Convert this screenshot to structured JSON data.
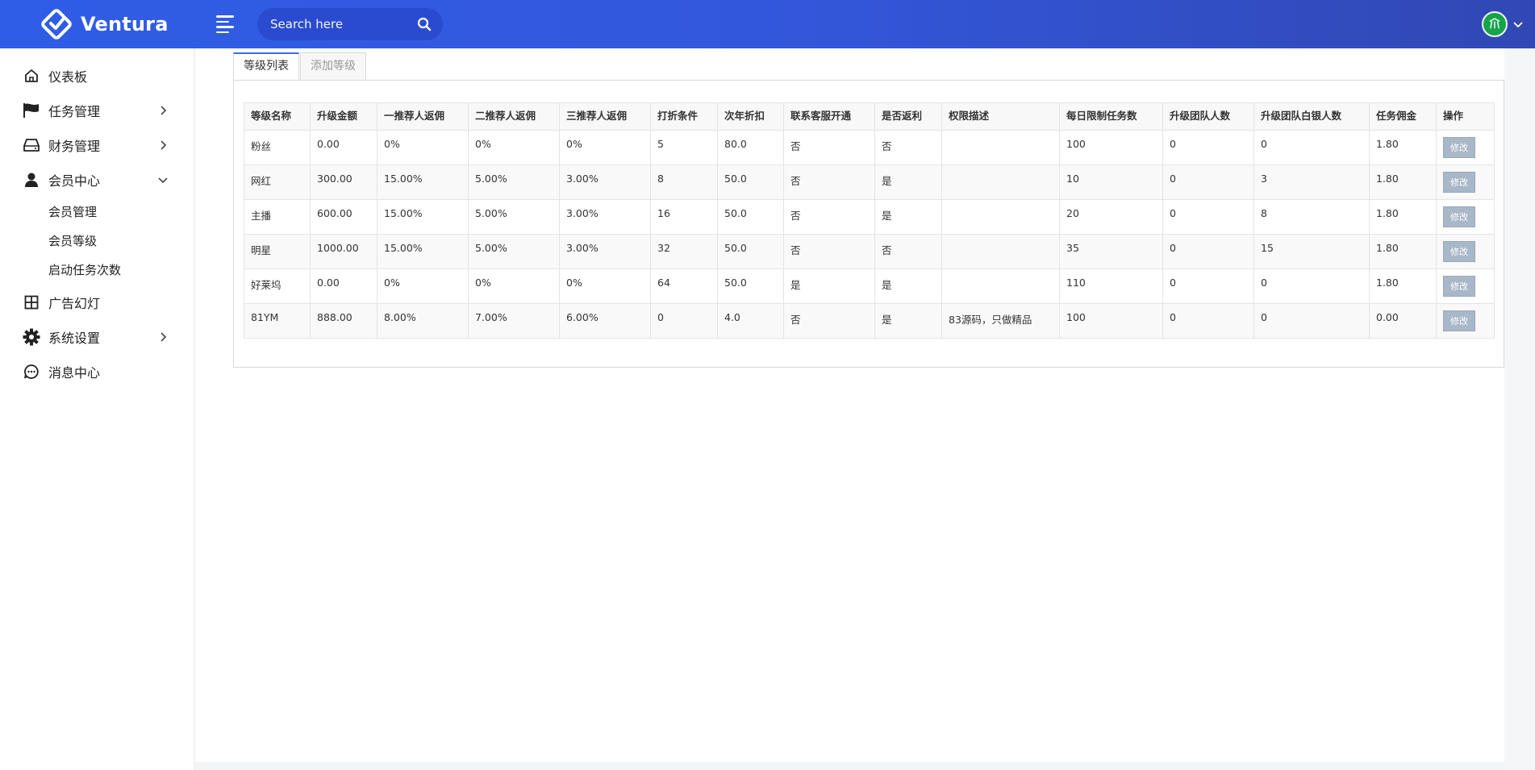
{
  "brand": {
    "name": "Ventura"
  },
  "search": {
    "placeholder": "Search here"
  },
  "sidebar": {
    "items": [
      {
        "label": "仪表板",
        "icon": "home-icon"
      },
      {
        "label": "任务管理",
        "icon": "flag-icon"
      },
      {
        "label": "财务管理",
        "icon": "drive-icon"
      },
      {
        "label": "会员中心",
        "icon": "user-icon"
      },
      {
        "label": "广告幻灯",
        "icon": "grid-icon"
      },
      {
        "label": "系统设置",
        "icon": "gear-icon"
      },
      {
        "label": "消息中心",
        "icon": "chat-icon"
      }
    ],
    "member_sub": [
      "会员管理",
      "会员等级",
      "启动任务次数"
    ]
  },
  "tabs": {
    "list": "等级列表",
    "add": "添加等级"
  },
  "table": {
    "headers": [
      "等级名称",
      "升级金额",
      "一推荐人返佣",
      "二推荐人返佣",
      "三推荐人返佣",
      "打折条件",
      "次年折扣",
      "联系客服开通",
      "是否返利",
      "权限描述",
      "每日限制任务数",
      "升级团队人数",
      "升级团队白银人数",
      "任务佣金",
      "操作"
    ],
    "edit_label": "修改",
    "rows": [
      [
        "粉丝",
        "0.00",
        "0%",
        "0%",
        "0%",
        "5",
        "80.0",
        "否",
        "否",
        "",
        "100",
        "0",
        "0",
        "1.80"
      ],
      [
        "网红",
        "300.00",
        "15.00%",
        "5.00%",
        "3.00%",
        "8",
        "50.0",
        "否",
        "是",
        "",
        "10",
        "0",
        "3",
        "1.80"
      ],
      [
        "主播",
        "600.00",
        "15.00%",
        "5.00%",
        "3.00%",
        "16",
        "50.0",
        "否",
        "是",
        "",
        "20",
        "0",
        "8",
        "1.80"
      ],
      [
        "明星",
        "1000.00",
        "15.00%",
        "5.00%",
        "3.00%",
        "32",
        "50.0",
        "否",
        "否",
        "",
        "35",
        "0",
        "15",
        "1.80"
      ],
      [
        "好莱坞",
        "0.00",
        "0%",
        "0%",
        "0%",
        "64",
        "50.0",
        "是",
        "是",
        "",
        "110",
        "0",
        "0",
        "1.80"
      ],
      [
        "81YM",
        "888.00",
        "8.00%",
        "7.00%",
        "6.00%",
        "0",
        "4.0",
        "否",
        "是",
        "83源码，只做精品",
        "100",
        "0",
        "0",
        "0.00"
      ]
    ]
  },
  "colors": {
    "topbar": "#2f5de6",
    "accent": "#3a6ee8",
    "edit_button": "#a9b8c8",
    "avatar": "#16a34a"
  }
}
